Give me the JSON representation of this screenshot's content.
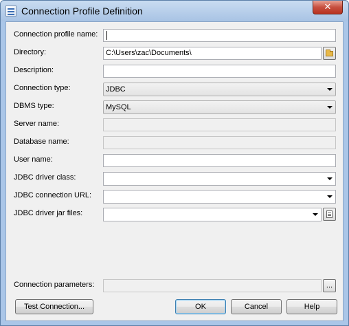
{
  "window": {
    "title": "Connection Profile Definition",
    "close_glyph": "✕"
  },
  "form": {
    "profile_name": {
      "label": "Connection profile name:",
      "value": ""
    },
    "directory": {
      "label": "Directory:",
      "value": "C:\\Users\\zac\\Documents\\"
    },
    "description": {
      "label": "Description:",
      "value": ""
    },
    "connection_type": {
      "label": "Connection type:",
      "value": "JDBC"
    },
    "dbms_type": {
      "label": "DBMS type:",
      "value": "MySQL"
    },
    "server_name": {
      "label": "Server name:",
      "value": ""
    },
    "database_name": {
      "label": "Database name:",
      "value": ""
    },
    "user_name": {
      "label": "User name:",
      "value": ""
    },
    "jdbc_driver_class": {
      "label": "JDBC driver class:",
      "value": ""
    },
    "jdbc_connection_url": {
      "label": "JDBC connection URL:",
      "value": ""
    },
    "jdbc_driver_jar_files": {
      "label": "JDBC driver jar files:",
      "value": ""
    },
    "connection_parameters": {
      "label": "Connection parameters:",
      "value": "",
      "button_label": "..."
    }
  },
  "buttons": {
    "test_connection": "Test Connection...",
    "ok": "OK",
    "cancel": "Cancel",
    "help": "Help"
  }
}
